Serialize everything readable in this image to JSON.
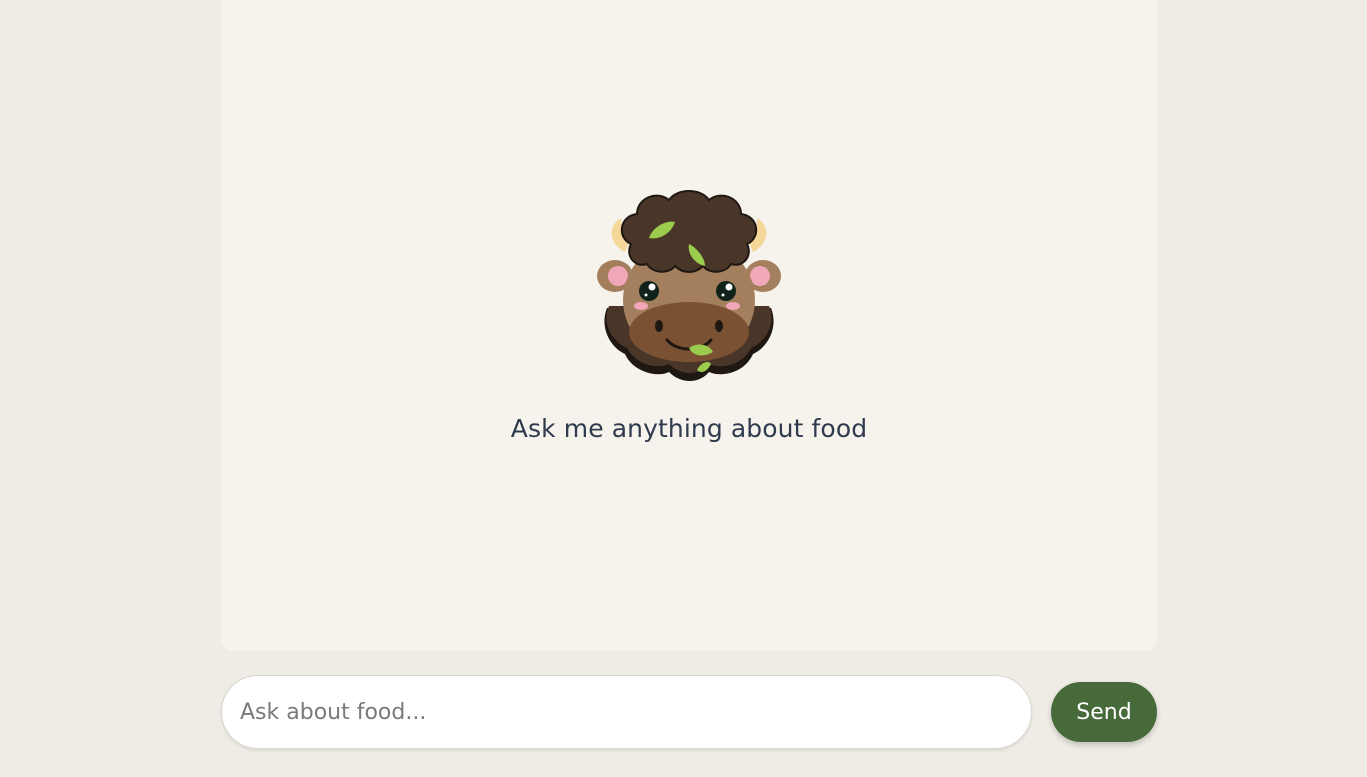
{
  "chat": {
    "empty_prompt": "Ask me anything about food",
    "mascot_icon": "bison-mascot-icon"
  },
  "composer": {
    "placeholder": "Ask about food...",
    "value": "",
    "send_label": "Send"
  },
  "colors": {
    "page_background": "#efebe5",
    "panel_background": "#f6f3ed",
    "send_button": "#466a39",
    "prompt_text": "#2f3a4d"
  }
}
